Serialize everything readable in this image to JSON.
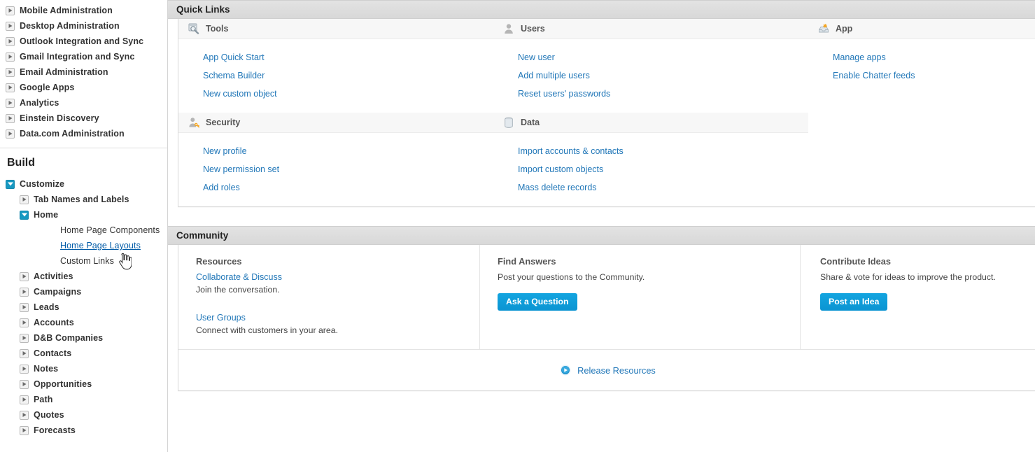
{
  "sidebar": {
    "top_items": [
      {
        "label": "Mobile Administration",
        "expanded": false
      },
      {
        "label": "Desktop Administration",
        "expanded": false
      },
      {
        "label": "Outlook Integration and Sync",
        "expanded": false
      },
      {
        "label": "Gmail Integration and Sync",
        "expanded": false
      },
      {
        "label": "Email Administration",
        "expanded": false
      },
      {
        "label": "Google Apps",
        "expanded": false
      },
      {
        "label": "Analytics",
        "expanded": false
      },
      {
        "label": "Einstein Discovery",
        "expanded": false
      },
      {
        "label": "Data.com Administration",
        "expanded": false
      }
    ],
    "build_title": "Build",
    "customize": {
      "label": "Customize",
      "expanded": true
    },
    "customize_children": [
      {
        "label": "Tab Names and Labels",
        "expanded": false
      },
      {
        "label": "Home",
        "expanded": true
      }
    ],
    "home_children": [
      {
        "label": "Home Page Components",
        "active": false
      },
      {
        "label": "Home Page Layouts",
        "active": true
      },
      {
        "label": "Custom Links",
        "active": false
      }
    ],
    "objects": [
      {
        "label": "Activities",
        "expanded": false
      },
      {
        "label": "Campaigns",
        "expanded": false
      },
      {
        "label": "Leads",
        "expanded": false
      },
      {
        "label": "Accounts",
        "expanded": false
      },
      {
        "label": "D&B Companies",
        "expanded": false
      },
      {
        "label": "Contacts",
        "expanded": false
      },
      {
        "label": "Notes",
        "expanded": false
      },
      {
        "label": "Opportunities",
        "expanded": false
      },
      {
        "label": "Path",
        "expanded": false
      },
      {
        "label": "Quotes",
        "expanded": false
      },
      {
        "label": "Forecasts",
        "expanded": false
      }
    ]
  },
  "quick_links": {
    "title": "Quick Links",
    "row1": [
      {
        "id": "tools",
        "icon": "tools-icon",
        "header": "Tools",
        "links": [
          "App Quick Start",
          "Schema Builder",
          "New custom object"
        ]
      },
      {
        "id": "users",
        "icon": "user-silhouette-icon",
        "header": "Users",
        "links": [
          "New user",
          "Add multiple users",
          "Reset users' passwords"
        ]
      },
      {
        "id": "app",
        "icon": "app-tray-icon",
        "header": "App",
        "links": [
          "Manage apps",
          "Enable Chatter feeds"
        ]
      }
    ],
    "row2": [
      {
        "id": "security",
        "icon": "user-key-icon",
        "header": "Security",
        "links": [
          "New profile",
          "New permission set",
          "Add roles"
        ]
      },
      {
        "id": "data",
        "icon": "database-icon",
        "header": "Data",
        "links": [
          "Import accounts & contacts",
          "Import custom objects",
          "Mass delete records"
        ]
      },
      {
        "id": "spacer",
        "icon": "",
        "header": "",
        "links": []
      }
    ]
  },
  "community": {
    "title": "Community",
    "columns": [
      {
        "id": "resources",
        "heading": "Resources",
        "entries": [
          {
            "link": "Collaborate & Discuss",
            "sub": "Join the conversation."
          },
          {
            "link": "User Groups",
            "sub": "Connect with customers in your area."
          }
        ],
        "button": null
      },
      {
        "id": "find-answers",
        "heading": "Find Answers",
        "entries": [
          {
            "link": null,
            "sub": "Post your questions to the Community."
          }
        ],
        "button": "Ask a Question"
      },
      {
        "id": "contribute-ideas",
        "heading": "Contribute Ideas",
        "entries": [
          {
            "link": null,
            "sub": "Share & vote for ideas to improve the product."
          }
        ],
        "button": "Post an Idea"
      }
    ],
    "footer_link": "Release Resources",
    "footer_icon": "play-circle-icon"
  },
  "colors": {
    "link_blue": "#2177b8",
    "button_blue": "#0d9dda",
    "twisty_expanded": "#1798c1",
    "panel_header_gray": "#dddddd",
    "col_header_gray": "#f7f7f7",
    "accent_orange": "#f5a623"
  }
}
